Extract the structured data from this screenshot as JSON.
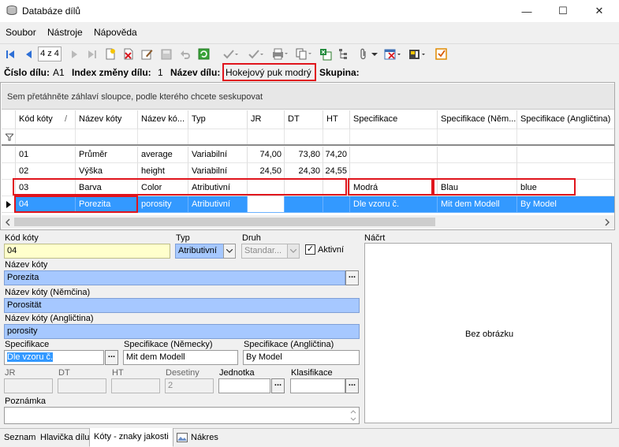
{
  "window": {
    "title": "Databáze dílů",
    "minimize": "—",
    "maximize": "☐",
    "close": "✕"
  },
  "menu": [
    "Soubor",
    "Nástroje",
    "Nápověda"
  ],
  "toolbar": {
    "record_position": "4 z 4",
    "icons": [
      "first-record-icon",
      "prev-record-icon",
      "next-record-icon",
      "last-record-icon",
      "new-icon",
      "delete-icon",
      "edit-icon",
      "save-icon",
      "undo-icon",
      "refresh-icon",
      "check-icon",
      "check-all-icon",
      "print-icon",
      "copy-icon",
      "excel-icon",
      "tree-icon",
      "attach-icon",
      "filter-icon",
      "export-icon",
      "checkbox-icon"
    ]
  },
  "part_info": {
    "cislo_label": "Číslo dílu:",
    "cislo_value": "A1",
    "index_label": "Index změny dílu:",
    "index_value": "1",
    "nazev_label": "Název dílu:",
    "nazev_value": "Hokejový puk modrý",
    "skupina_label": "Skupina:"
  },
  "grid": {
    "group_hint": "Sem přetáhněte záhlaví sloupce, podle kterého chcete seskupovat",
    "columns": [
      "Kód kóty",
      "Název kóty",
      "Název kó...",
      "Typ",
      "JR",
      "DT",
      "HT",
      "Specifikace",
      "Specifikace (Něm...",
      "Specifikace (Angličtina)"
    ],
    "sort_indicator": "/",
    "rows": [
      {
        "kod": "01",
        "nazev": "Průměr",
        "nazev_en": "average",
        "typ": "Variabilní",
        "jr": "74,00",
        "dt": "73,80",
        "ht": "74,20",
        "spec": "",
        "spec_de": "",
        "spec_en": ""
      },
      {
        "kod": "02",
        "nazev": "Výška",
        "nazev_en": "height",
        "typ": "Variabilní",
        "jr": "24,50",
        "dt": "24,30",
        "ht": "24,55",
        "spec": "",
        "spec_de": "",
        "spec_en": ""
      },
      {
        "kod": "03",
        "nazev": "Barva",
        "nazev_en": "Color",
        "typ": "Atributivní",
        "jr": "",
        "dt": "",
        "ht": "",
        "spec": "Modrá",
        "spec_de": "Blau",
        "spec_en": "blue"
      },
      {
        "kod": "04",
        "nazev": "Porezita",
        "nazev_en": "porosity",
        "typ": "Atributivní",
        "jr": "",
        "dt": "",
        "ht": "",
        "spec": "Dle vzoru č.",
        "spec_de": "Mit dem Modell",
        "spec_en": "By Model"
      }
    ]
  },
  "form": {
    "kod_label": "Kód kóty",
    "kod_value": "04",
    "typ_label": "Typ",
    "typ_value": "Atributivní",
    "druh_label": "Druh",
    "druh_value": "Standar...",
    "aktivni_label": "Aktivní",
    "aktivni_mark": "✓",
    "nazev_label": "Název kóty",
    "nazev_value": "Porezita",
    "nazev_de_label": "Název kóty (Němčina)",
    "nazev_de_value": "Porosität",
    "nazev_en_label": "Název kóty (Angličtina)",
    "nazev_en_value": "porosity",
    "spec_label": "Specifikace",
    "spec_value": "Dle vzoru č.",
    "spec_de_label": "Specifikace (Německy)",
    "spec_de_value": "Mit dem Modell",
    "spec_en_label": "Specifikace (Angličtina)",
    "spec_en_value": "By Model",
    "jr_label": "JR",
    "dt_label": "DT",
    "ht_label": "HT",
    "desetiny_label": "Desetiny",
    "desetiny_value": "2",
    "jednotka_label": "Jednotka",
    "klasifikace_label": "Klasifikace",
    "poznamka_label": "Poznámka",
    "nacrt_label": "Náčrt",
    "no_image": "Bez obrázku",
    "dots": "..."
  },
  "tabs": [
    "Seznam",
    "Hlavička dílu",
    "Kóty - znaky jakosti",
    "Nákres"
  ]
}
